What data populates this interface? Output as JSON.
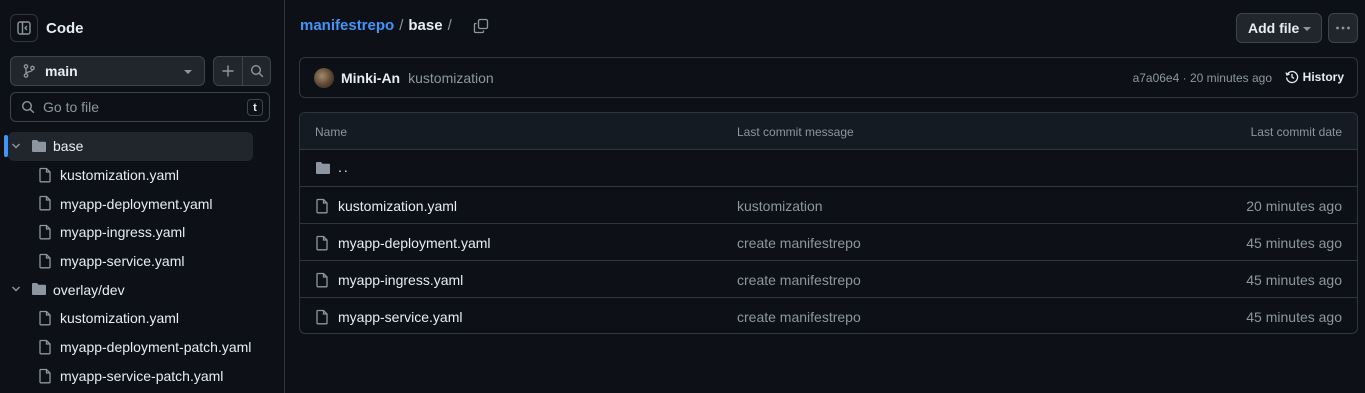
{
  "sidebar": {
    "title": "Code",
    "toggle_icon": "sidebar-collapse-icon",
    "branch": "main",
    "search_placeholder": "Go to file",
    "search_shortcut": "t",
    "tree": [
      {
        "type": "dir",
        "label": "base",
        "expanded": true,
        "selected": true
      },
      {
        "type": "file",
        "label": "kustomization.yaml"
      },
      {
        "type": "file",
        "label": "myapp-deployment.yaml"
      },
      {
        "type": "file",
        "label": "myapp-ingress.yaml"
      },
      {
        "type": "file",
        "label": "myapp-service.yaml"
      },
      {
        "type": "dir",
        "label": "overlay/dev",
        "expanded": true
      },
      {
        "type": "file",
        "label": "kustomization.yaml"
      },
      {
        "type": "file",
        "label": "myapp-deployment-patch.yaml"
      },
      {
        "type": "file",
        "label": "myapp-service-patch.yaml"
      }
    ]
  },
  "breadcrumb": {
    "repo": "manifestrepo",
    "sep1": "/",
    "current": "base",
    "sep2": "/"
  },
  "toolbar": {
    "add_file_label": "Add file",
    "more_icon": "kebab-horizontal-icon"
  },
  "commit": {
    "author": "Minki-An",
    "message": "kustomization",
    "meta": "a7a06e4 · 20 minutes ago",
    "history_label": "History"
  },
  "files_table": {
    "headers": [
      "Name",
      "Last commit message",
      "Last commit date"
    ],
    "parent_label": "..",
    "rows": [
      {
        "name": "kustomization.yaml",
        "message": "kustomization",
        "date": "20 minutes ago"
      },
      {
        "name": "myapp-deployment.yaml",
        "message": "create manifestrepo",
        "date": "45 minutes ago"
      },
      {
        "name": "myapp-ingress.yaml",
        "message": "create manifestrepo",
        "date": "45 minutes ago"
      },
      {
        "name": "myapp-service.yaml",
        "message": "create manifestrepo",
        "date": "45 minutes ago"
      }
    ]
  },
  "colors": {
    "background": "#0d1117",
    "accent": "#4493f8",
    "border": "#30363d",
    "muted_text": "#8d96a0"
  }
}
